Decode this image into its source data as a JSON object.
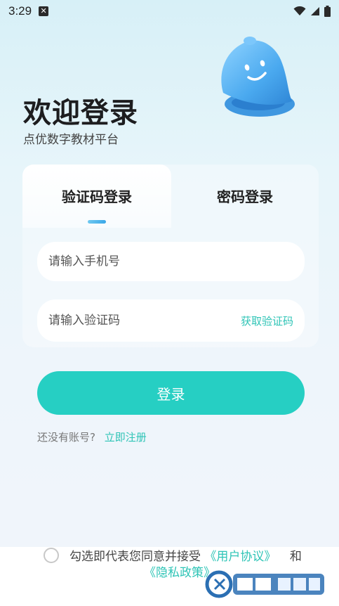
{
  "status_bar": {
    "time": "3:29"
  },
  "header": {
    "title": "欢迎登录",
    "subtitle": "点优数字教材平台"
  },
  "tabs": [
    {
      "label": "验证码登录",
      "active": true
    },
    {
      "label": "密码登录",
      "active": false
    }
  ],
  "form": {
    "phone_placeholder": "请输入手机号",
    "code_placeholder": "请输入验证码",
    "get_code_label": "获取验证码"
  },
  "login_button": "登录",
  "register": {
    "question": "还没有账号?",
    "link": "立即注册"
  },
  "agreement": {
    "prefix": "勾选即代表您同意并接受",
    "user_agreement": "《用户协议》",
    "and": "和",
    "privacy_policy": "《隐私政策》"
  },
  "colors": {
    "accent": "#26cfc3",
    "link": "#2ec4b6",
    "bell": "#4aa9ef"
  },
  "icons": [
    "close-notification-icon",
    "wifi-icon",
    "signal-icon",
    "battery-icon",
    "bell-mascot-icon",
    "watermark-logo"
  ]
}
